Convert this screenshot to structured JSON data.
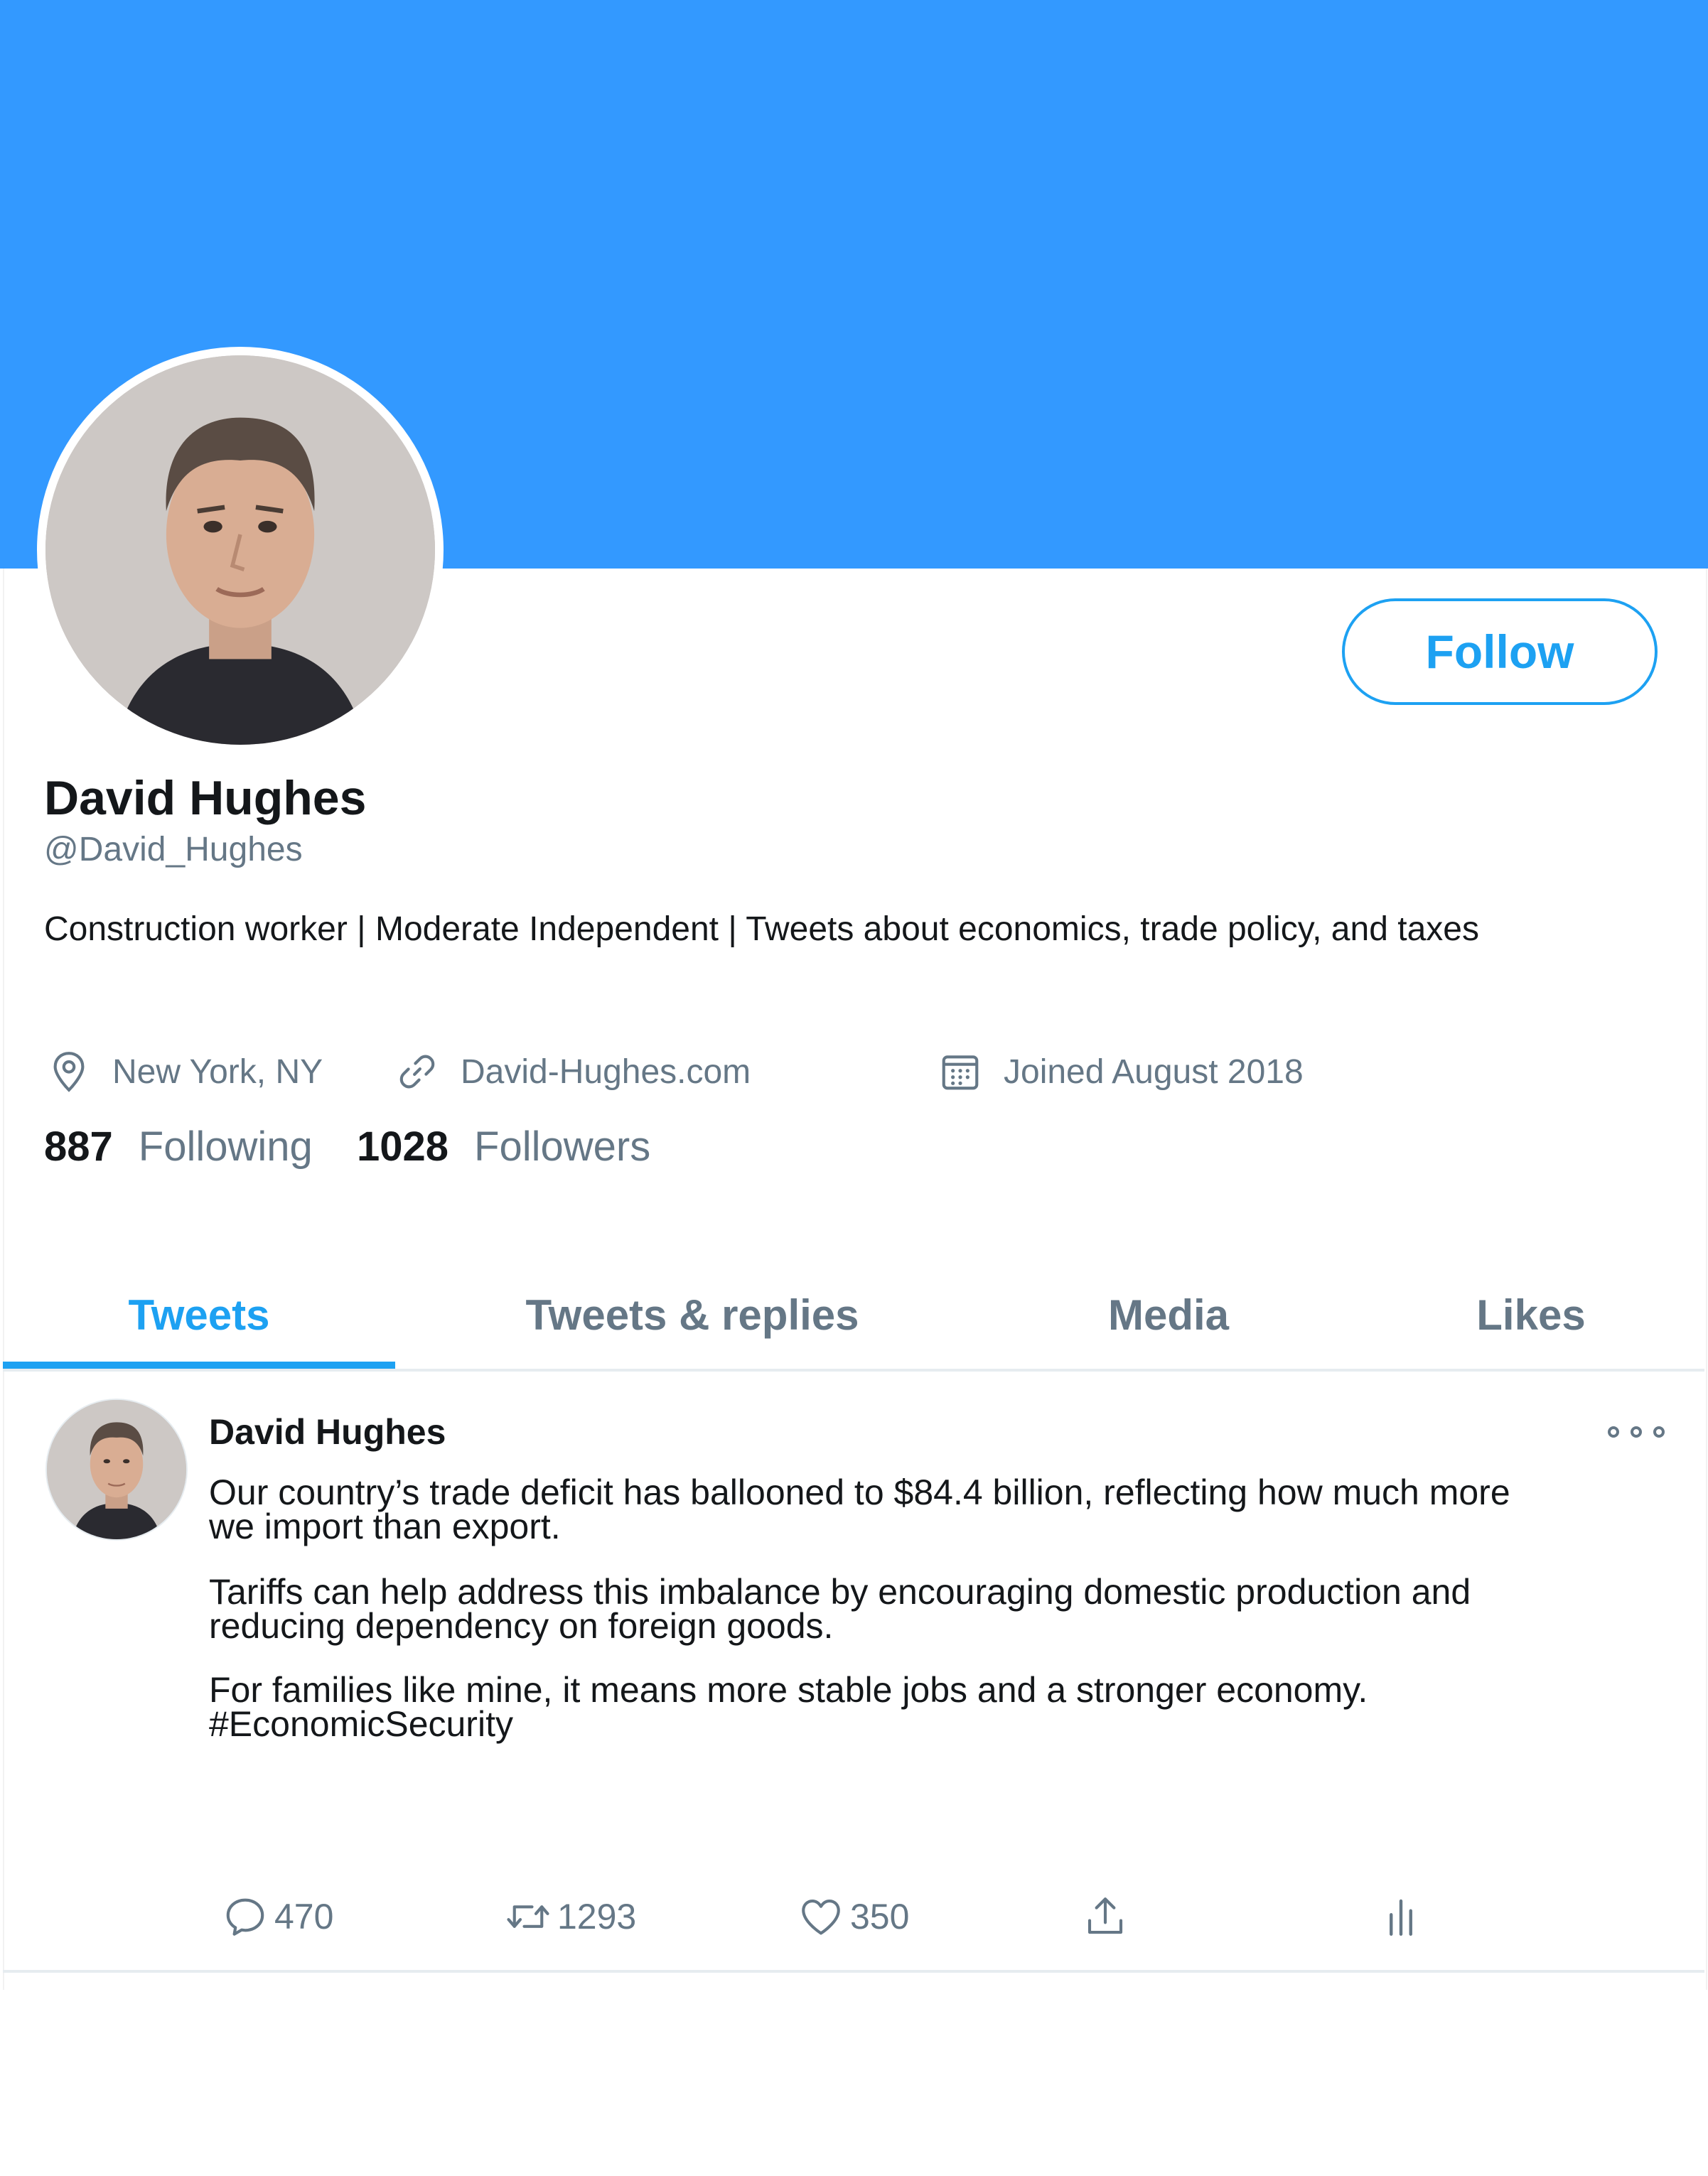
{
  "profile": {
    "name": "David Hughes",
    "handle": "@David_Hughes",
    "bio": "Construction worker | Moderate Independent | Tweets about economics, trade policy, and taxes",
    "follow_label": "Follow",
    "location": "New York, NY",
    "website": "David-Hughes.com",
    "joined": "Joined August 2018",
    "following_count": "887",
    "following_label": "Following",
    "followers_count": "1028",
    "followers_label": "Followers"
  },
  "tabs": [
    {
      "label": "Tweets",
      "active": true
    },
    {
      "label": "Tweets & replies",
      "active": false
    },
    {
      "label": "Media",
      "active": false
    },
    {
      "label": "Likes",
      "active": false
    }
  ],
  "tweet": {
    "author": "David Hughes",
    "paragraph1_line1": "Our country’s trade deficit has ballooned to $84.4 billion, reflecting how much more",
    "paragraph1_line2": "we import than export.",
    "paragraph2_line1": "Tariffs can help address this imbalance by encouraging domestic production and",
    "paragraph2_line2": "reducing dependency on foreign goods.",
    "paragraph3_line1": "For families like mine, it means more stable jobs and a stronger economy.",
    "paragraph3_line2": "#EconomicSecurity",
    "replies": "470",
    "retweets": "1293",
    "likes": "350"
  },
  "colors": {
    "banner": "#3399ff",
    "accent": "#1da1f2",
    "secondary_text": "#657786",
    "primary_text": "#14171a"
  },
  "icons": [
    "location-pin-icon",
    "link-icon",
    "calendar-icon",
    "more-options-icon",
    "reply-icon",
    "retweet-icon",
    "like-heart-icon",
    "share-icon",
    "analytics-icon"
  ]
}
